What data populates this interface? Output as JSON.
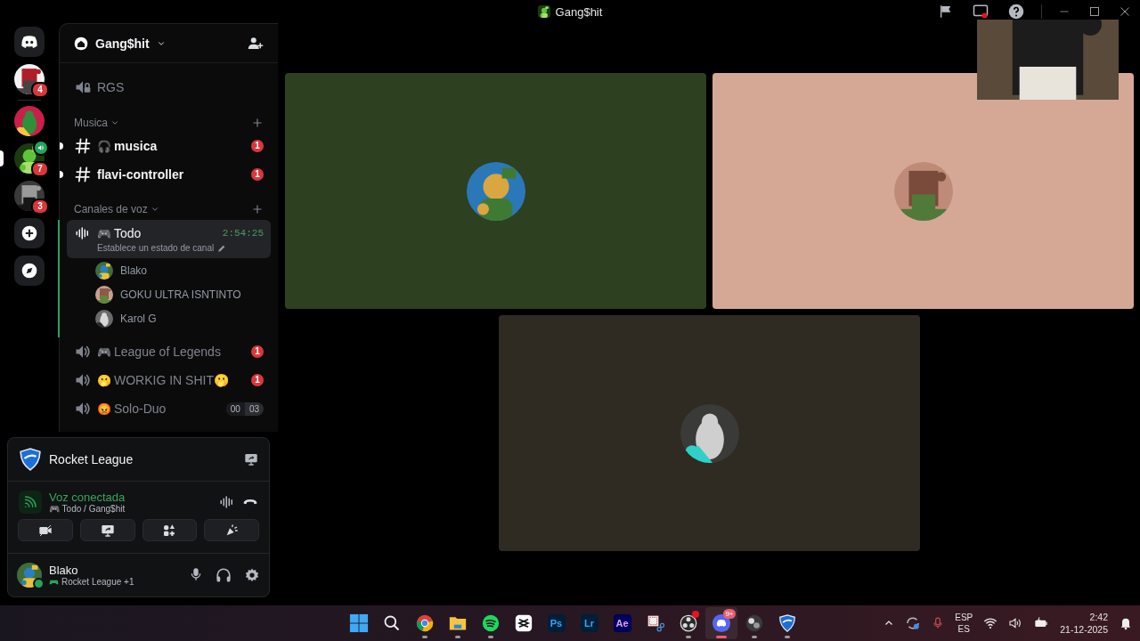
{
  "window": {
    "title": "Gang$hit"
  },
  "servers": [
    {
      "kind": "home",
      "selected": false
    },
    {
      "kind": "server",
      "selected": false,
      "badge": "4",
      "in_voice": false
    },
    {
      "kind": "server",
      "selected": false,
      "in_voice": false
    },
    {
      "kind": "server",
      "selected": true,
      "badge": "7",
      "in_voice": true
    },
    {
      "kind": "server",
      "selected": false,
      "badge": "3",
      "in_voice": false
    },
    {
      "kind": "add",
      "selected": false
    },
    {
      "kind": "discover",
      "selected": false
    }
  ],
  "server_header": {
    "name": "Gang$hit"
  },
  "channels": [
    {
      "kind": "voice-locked",
      "name": "RGS",
      "unread": false
    },
    {
      "kind": "category",
      "name": "Musica"
    },
    {
      "kind": "text",
      "emoji": "🎧",
      "name": "musica",
      "unread": true,
      "badge": "1"
    },
    {
      "kind": "text",
      "name": "flavi-controller",
      "unread": true,
      "badge": "1"
    },
    {
      "kind": "category",
      "name": "Canales de voz"
    },
    {
      "kind": "voice",
      "emoji": "🎮",
      "name": "Todo",
      "selected": true,
      "timer": "2:54:25",
      "status": "Establece un estado de canal",
      "members": [
        {
          "name": "Blako"
        },
        {
          "name": "GOKU ULTRA ISNTINTO"
        },
        {
          "name": "Karol G"
        }
      ]
    },
    {
      "kind": "voice",
      "emoji": "🎮",
      "name": "League of Legends",
      "selected": false,
      "badge": "1"
    },
    {
      "kind": "voice",
      "emoji": "🫢",
      "name": "WORKIG IN SHIT🫢",
      "selected": false,
      "badge": "1"
    },
    {
      "kind": "voice",
      "emoji": "😡",
      "name": "Solo-Duo",
      "selected": false,
      "limit": [
        "00",
        "03"
      ]
    }
  ],
  "activity": {
    "name": "Rocket League"
  },
  "voice_status": {
    "label": "Voz conectada",
    "emoji": "🎮",
    "channel": "Todo / Gang$hit"
  },
  "user": {
    "name": "Blako",
    "activity": "Rocket League +1",
    "online": true
  },
  "tiles": [
    {
      "color": "#2d4020"
    },
    {
      "color": "#d4a894"
    },
    {
      "color": "#2f2b22"
    }
  ],
  "taskbar": [
    {
      "kind": "start",
      "running": false,
      "active": false
    },
    {
      "kind": "search",
      "running": false,
      "active": false
    },
    {
      "kind": "chrome",
      "running": true,
      "active": false
    },
    {
      "kind": "files",
      "running": true,
      "active": false
    },
    {
      "kind": "spotify",
      "running": true,
      "active": false
    },
    {
      "kind": "capcut",
      "running": false,
      "active": false
    },
    {
      "kind": "photoshop",
      "label": "Ps",
      "running": false,
      "active": false
    },
    {
      "kind": "lightroom",
      "label": "Lr",
      "running": false,
      "active": false
    },
    {
      "kind": "after-effects",
      "label": "Ae",
      "running": false,
      "active": false
    },
    {
      "kind": "snip",
      "running": false,
      "active": false
    },
    {
      "kind": "obs",
      "running": true,
      "active": false,
      "dot": true
    },
    {
      "kind": "discord",
      "running": true,
      "active": true,
      "badge": "9+"
    },
    {
      "kind": "bm",
      "running": true,
      "active": false
    },
    {
      "kind": "rocket",
      "running": true,
      "active": false
    }
  ],
  "tray": {
    "lang": "ESP",
    "layout": "ES",
    "time": "2:42",
    "date": "21-12-2025"
  }
}
